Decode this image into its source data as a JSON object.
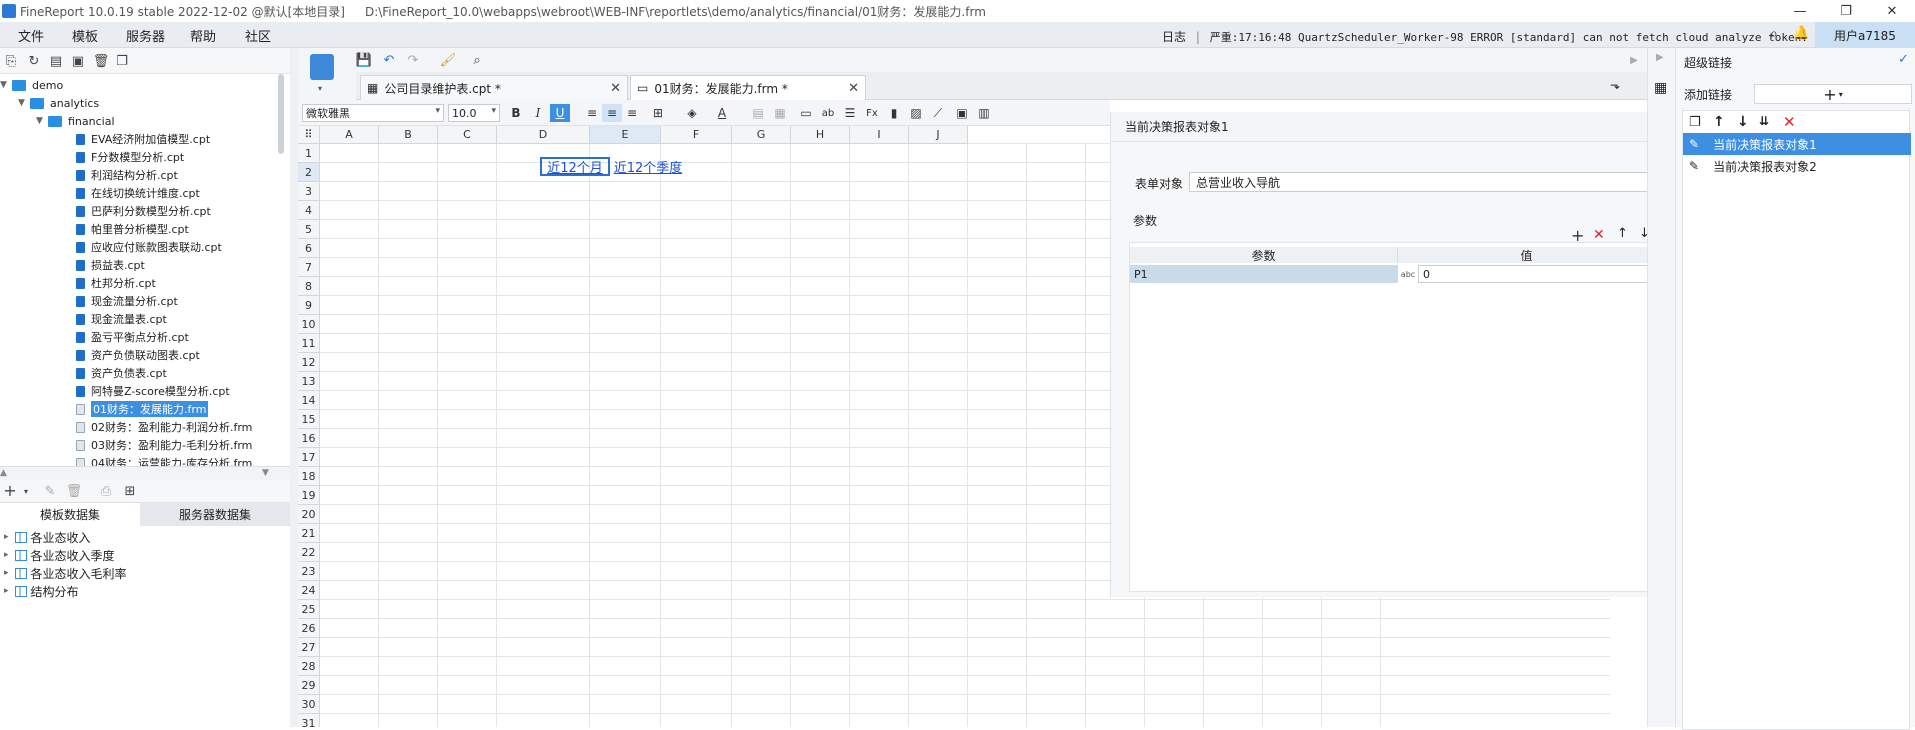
{
  "titlebar": {
    "title": "FineReport 10.0.19 stable 2022-12-02 @默认[本地目录]",
    "path": "D:\\FineReport_10.0\\webapps\\webroot\\WEB-INF\\reportlets\\demo/analytics/financial/01财务：发展能力.frm",
    "controls": [
      "—",
      "❐",
      "✕"
    ]
  },
  "menubar": {
    "items": [
      "文件",
      "模板",
      "服务器",
      "帮助",
      "社区"
    ],
    "log_label": "日志",
    "log_message": "严重:17:16:48 QuartzScheduler_Worker-98 ERROR [standard] can not fetch cloud analyze token.",
    "user": "用户a7185"
  },
  "tree": {
    "root": "demo",
    "child": "analytics",
    "grandchild": "financial",
    "files": [
      "EVA经济附加值模型.cpt",
      "F分数模型分析.cpt",
      "利润结构分析.cpt",
      "在线切换统计维度.cpt",
      "巴萨利分数模型分析.cpt",
      "帕里普分析模型.cpt",
      "应收应付账款图表联动.cpt",
      "损益表.cpt",
      "杜邦分析.cpt",
      "现金流量分析.cpt",
      "现金流量表.cpt",
      "盈亏平衡点分析.cpt",
      "资产负债联动图表.cpt",
      "资产负债表.cpt",
      "阿特曼Z-score模型分析.cpt",
      "01财务：发展能力.frm",
      "02财务：盈利能力-利润分析.frm",
      "03财务：盈利能力-毛利分析.frm",
      "04财务：运营能力-库存分析.frm"
    ],
    "selected_index": 15
  },
  "datasets": {
    "tabs": [
      "模板数据集",
      "服务器数据集"
    ],
    "items": [
      "各业态收入",
      "各业态收入季度",
      "各业态收入毛利率",
      "结构分布"
    ]
  },
  "tabs": [
    {
      "label": "公司目录维护表.cpt *"
    },
    {
      "label": "01财务：发展能力.frm *"
    }
  ],
  "format": {
    "font": "微软雅黑",
    "size": "10.0",
    "bold": "B",
    "italic": "I",
    "underline": "U",
    "ab": "ab"
  },
  "grid": {
    "columns": [
      "A",
      "B",
      "C",
      "D",
      "E",
      "F",
      "G",
      "H",
      "I",
      "J"
    ],
    "rows": [
      "1",
      "2",
      "3",
      "4",
      "5",
      "6",
      "7",
      "8",
      "9",
      "10",
      "11",
      "12",
      "13",
      "14",
      "15",
      "16",
      "17",
      "18",
      "19",
      "20",
      "21",
      "22",
      "23",
      "24",
      "25",
      "26",
      "27",
      "28",
      "29",
      "30",
      "31"
    ],
    "e2": "近12个月",
    "f2": "近12个季度"
  },
  "decision": {
    "header": "当前决策报表对象1",
    "form_label": "表单对象",
    "form_value": "总营业收入导航",
    "params_label": "参数",
    "col_param": "参数",
    "col_value": "值",
    "p_name": "P1",
    "p_type": "abc",
    "p_value": "0"
  },
  "hyperlink": {
    "title": "超级链接",
    "add_label": "添加链接",
    "items": [
      "当前决策报表对象1",
      "当前决策报表对象2"
    ],
    "selected_index": 0
  },
  "colors": {
    "accent": "#3c8fe3",
    "link": "#1a4fd8",
    "delete": "#e02626"
  }
}
